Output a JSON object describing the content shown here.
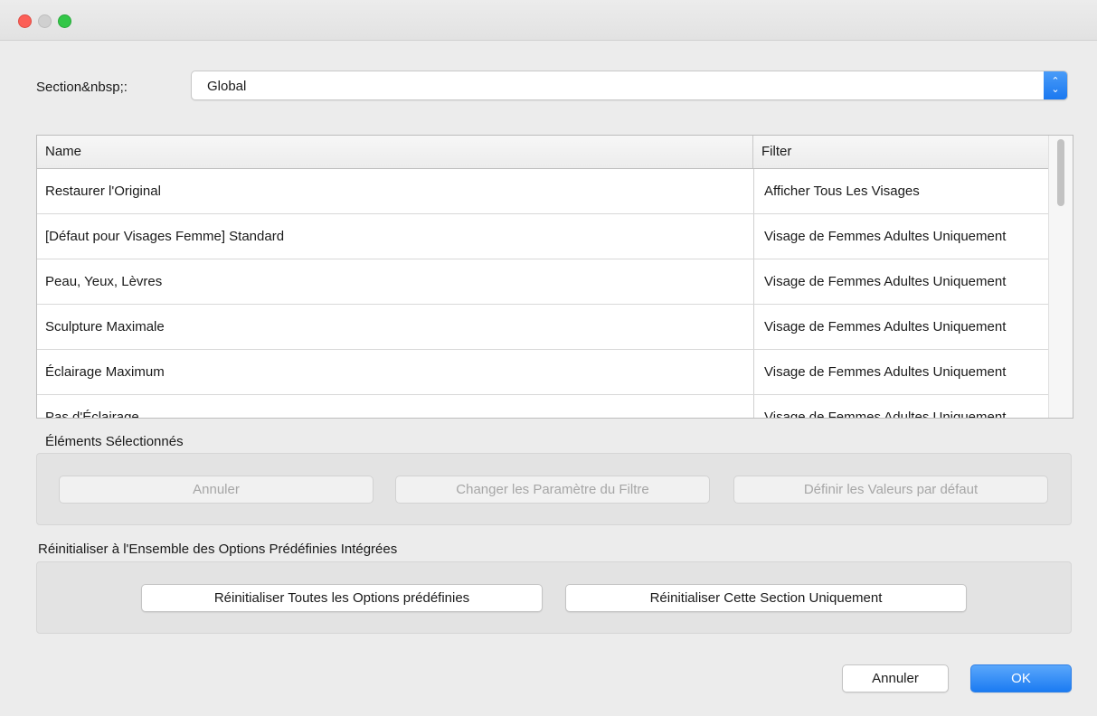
{
  "window": {
    "controls": [
      "close",
      "minimize",
      "zoom"
    ]
  },
  "section": {
    "label": "Section&nbsp;:",
    "value": "Global",
    "stepper_icon": "updown-chevron-icon"
  },
  "table": {
    "columns": [
      "Name",
      "Filter"
    ],
    "rows": [
      {
        "name": "Restaurer l'Original",
        "filter": "Afficher Tous Les Visages"
      },
      {
        "name": "[Défaut pour Visages Femme] Standard",
        "filter": "Visage de Femmes Adultes Uniquement"
      },
      {
        "name": "Peau, Yeux, Lèvres",
        "filter": "Visage de Femmes Adultes Uniquement"
      },
      {
        "name": "Sculpture Maximale",
        "filter": "Visage de Femmes Adultes Uniquement"
      },
      {
        "name": "Éclairage Maximum",
        "filter": "Visage de Femmes Adultes Uniquement"
      },
      {
        "name": "Pas d'Éclairage",
        "filter": "Visage de Femmes Adultes Uniquement"
      }
    ]
  },
  "selected_items": {
    "label": "Éléments Sélectionnés",
    "buttons": {
      "cancel": "Annuler",
      "change_filter": "Changer les Paramètre du Filtre",
      "set_defaults": "Définir les Valeurs par défaut"
    }
  },
  "reset": {
    "label": "Réinitialiser à l'Ensemble des Options Prédéfinies Intégrées",
    "buttons": {
      "reset_all": "Réinitialiser Toutes les Options prédéfinies",
      "reset_section": "Réinitialiser Cette Section Uniquement"
    }
  },
  "footer": {
    "cancel": "Annuler",
    "ok": "OK"
  },
  "colors": {
    "accent": "#1b7bf2",
    "close": "#fc5f57",
    "zoom": "#33c748"
  }
}
